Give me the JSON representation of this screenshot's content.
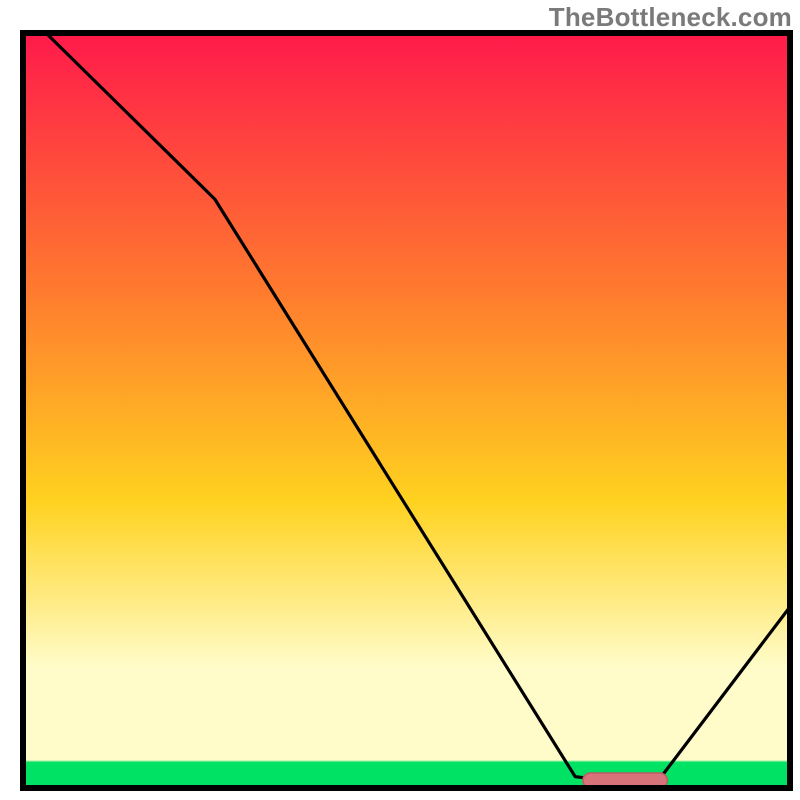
{
  "watermark": "TheBottleneck.com",
  "colors": {
    "top": "#ff1a4b",
    "mid1": "#ff7a2e",
    "mid2": "#ffd21f",
    "pale": "#fffcc9",
    "green": "#00e264",
    "curve": "#000000",
    "border": "#000000",
    "indicator_fill": "#d9737a",
    "indicator_stroke": "#c05a63"
  },
  "chart_data": {
    "type": "line",
    "title": "",
    "xlabel": "",
    "ylabel": "",
    "xlim": [
      0,
      100
    ],
    "ylim": [
      0,
      100
    ],
    "series": [
      {
        "name": "curve",
        "points": [
          {
            "x": 3,
            "y": 100
          },
          {
            "x": 25,
            "y": 78
          },
          {
            "x": 72,
            "y": 1.5
          },
          {
            "x": 78,
            "y": 0.8
          },
          {
            "x": 83,
            "y": 1.2
          },
          {
            "x": 100,
            "y": 24
          }
        ]
      }
    ],
    "indicator": {
      "x_start": 73,
      "x_end": 84,
      "y": 1
    }
  },
  "plot_layout": {
    "inner_left": 23,
    "inner_top": 33,
    "inner_width": 767,
    "inner_height": 755,
    "green_band_top_frac": 0.963,
    "pale_band_top_frac": 0.84
  }
}
